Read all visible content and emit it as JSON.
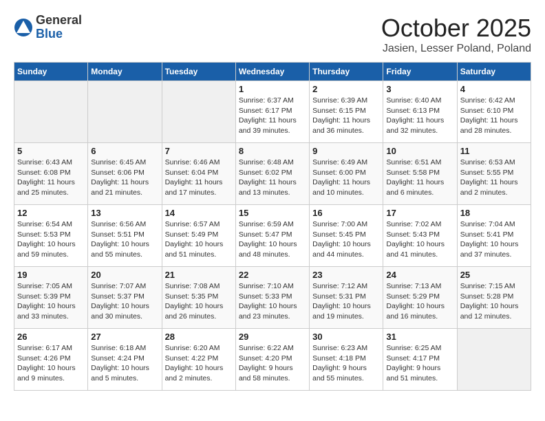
{
  "header": {
    "logo": {
      "general": "General",
      "blue": "Blue"
    },
    "title": "October 2025",
    "location": "Jasien, Lesser Poland, Poland"
  },
  "calendar": {
    "weekdays": [
      "Sunday",
      "Monday",
      "Tuesday",
      "Wednesday",
      "Thursday",
      "Friday",
      "Saturday"
    ],
    "weeks": [
      [
        {
          "day": "",
          "info": ""
        },
        {
          "day": "",
          "info": ""
        },
        {
          "day": "",
          "info": ""
        },
        {
          "day": "1",
          "info": "Sunrise: 6:37 AM\nSunset: 6:17 PM\nDaylight: 11 hours\nand 39 minutes."
        },
        {
          "day": "2",
          "info": "Sunrise: 6:39 AM\nSunset: 6:15 PM\nDaylight: 11 hours\nand 36 minutes."
        },
        {
          "day": "3",
          "info": "Sunrise: 6:40 AM\nSunset: 6:13 PM\nDaylight: 11 hours\nand 32 minutes."
        },
        {
          "day": "4",
          "info": "Sunrise: 6:42 AM\nSunset: 6:10 PM\nDaylight: 11 hours\nand 28 minutes."
        }
      ],
      [
        {
          "day": "5",
          "info": "Sunrise: 6:43 AM\nSunset: 6:08 PM\nDaylight: 11 hours\nand 25 minutes."
        },
        {
          "day": "6",
          "info": "Sunrise: 6:45 AM\nSunset: 6:06 PM\nDaylight: 11 hours\nand 21 minutes."
        },
        {
          "day": "7",
          "info": "Sunrise: 6:46 AM\nSunset: 6:04 PM\nDaylight: 11 hours\nand 17 minutes."
        },
        {
          "day": "8",
          "info": "Sunrise: 6:48 AM\nSunset: 6:02 PM\nDaylight: 11 hours\nand 13 minutes."
        },
        {
          "day": "9",
          "info": "Sunrise: 6:49 AM\nSunset: 6:00 PM\nDaylight: 11 hours\nand 10 minutes."
        },
        {
          "day": "10",
          "info": "Sunrise: 6:51 AM\nSunset: 5:58 PM\nDaylight: 11 hours\nand 6 minutes."
        },
        {
          "day": "11",
          "info": "Sunrise: 6:53 AM\nSunset: 5:55 PM\nDaylight: 11 hours\nand 2 minutes."
        }
      ],
      [
        {
          "day": "12",
          "info": "Sunrise: 6:54 AM\nSunset: 5:53 PM\nDaylight: 10 hours\nand 59 minutes."
        },
        {
          "day": "13",
          "info": "Sunrise: 6:56 AM\nSunset: 5:51 PM\nDaylight: 10 hours\nand 55 minutes."
        },
        {
          "day": "14",
          "info": "Sunrise: 6:57 AM\nSunset: 5:49 PM\nDaylight: 10 hours\nand 51 minutes."
        },
        {
          "day": "15",
          "info": "Sunrise: 6:59 AM\nSunset: 5:47 PM\nDaylight: 10 hours\nand 48 minutes."
        },
        {
          "day": "16",
          "info": "Sunrise: 7:00 AM\nSunset: 5:45 PM\nDaylight: 10 hours\nand 44 minutes."
        },
        {
          "day": "17",
          "info": "Sunrise: 7:02 AM\nSunset: 5:43 PM\nDaylight: 10 hours\nand 41 minutes."
        },
        {
          "day": "18",
          "info": "Sunrise: 7:04 AM\nSunset: 5:41 PM\nDaylight: 10 hours\nand 37 minutes."
        }
      ],
      [
        {
          "day": "19",
          "info": "Sunrise: 7:05 AM\nSunset: 5:39 PM\nDaylight: 10 hours\nand 33 minutes."
        },
        {
          "day": "20",
          "info": "Sunrise: 7:07 AM\nSunset: 5:37 PM\nDaylight: 10 hours\nand 30 minutes."
        },
        {
          "day": "21",
          "info": "Sunrise: 7:08 AM\nSunset: 5:35 PM\nDaylight: 10 hours\nand 26 minutes."
        },
        {
          "day": "22",
          "info": "Sunrise: 7:10 AM\nSunset: 5:33 PM\nDaylight: 10 hours\nand 23 minutes."
        },
        {
          "day": "23",
          "info": "Sunrise: 7:12 AM\nSunset: 5:31 PM\nDaylight: 10 hours\nand 19 minutes."
        },
        {
          "day": "24",
          "info": "Sunrise: 7:13 AM\nSunset: 5:29 PM\nDaylight: 10 hours\nand 16 minutes."
        },
        {
          "day": "25",
          "info": "Sunrise: 7:15 AM\nSunset: 5:28 PM\nDaylight: 10 hours\nand 12 minutes."
        }
      ],
      [
        {
          "day": "26",
          "info": "Sunrise: 6:17 AM\nSunset: 4:26 PM\nDaylight: 10 hours\nand 9 minutes."
        },
        {
          "day": "27",
          "info": "Sunrise: 6:18 AM\nSunset: 4:24 PM\nDaylight: 10 hours\nand 5 minutes."
        },
        {
          "day": "28",
          "info": "Sunrise: 6:20 AM\nSunset: 4:22 PM\nDaylight: 10 hours\nand 2 minutes."
        },
        {
          "day": "29",
          "info": "Sunrise: 6:22 AM\nSunset: 4:20 PM\nDaylight: 9 hours\nand 58 minutes."
        },
        {
          "day": "30",
          "info": "Sunrise: 6:23 AM\nSunset: 4:18 PM\nDaylight: 9 hours\nand 55 minutes."
        },
        {
          "day": "31",
          "info": "Sunrise: 6:25 AM\nSunset: 4:17 PM\nDaylight: 9 hours\nand 51 minutes."
        },
        {
          "day": "",
          "info": ""
        }
      ]
    ]
  }
}
